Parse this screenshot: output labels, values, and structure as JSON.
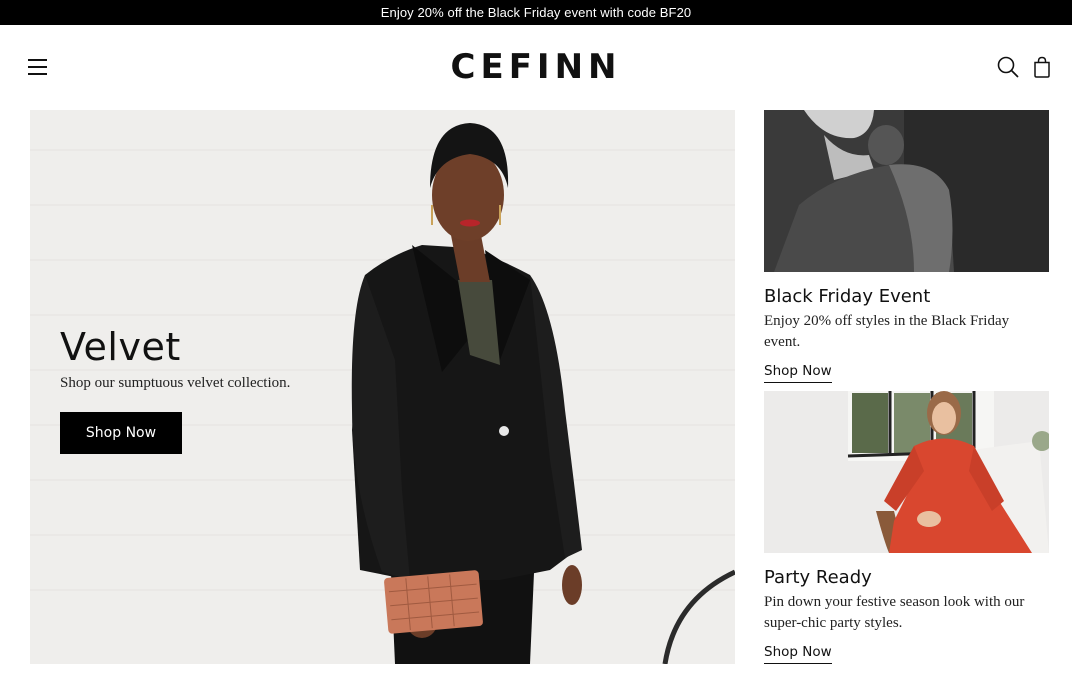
{
  "promo_bar": {
    "text": "Enjoy 20% off the Black Friday event with code BF20"
  },
  "header": {
    "logo": "CEFINN",
    "menu_icon": "hamburger-menu-icon",
    "search_icon": "search-icon",
    "bag_icon": "shopping-bag-icon"
  },
  "hero": {
    "title": "Velvet",
    "subtitle": "Shop our sumptuous velvet collection.",
    "button_label": "Shop Now"
  },
  "cards": [
    {
      "title": "Black Friday Event",
      "description": "Enjoy 20% off styles in the Black Friday event.",
      "link_label": "Shop Now"
    },
    {
      "title": "Party Ready",
      "description": "Pin down your festive season look with our super-chic party styles.",
      "link_label": "Shop Now"
    }
  ],
  "colors": {
    "promo_bar_bg": "#000000",
    "button_bg": "#000000",
    "accent_red": "#d9472f"
  }
}
